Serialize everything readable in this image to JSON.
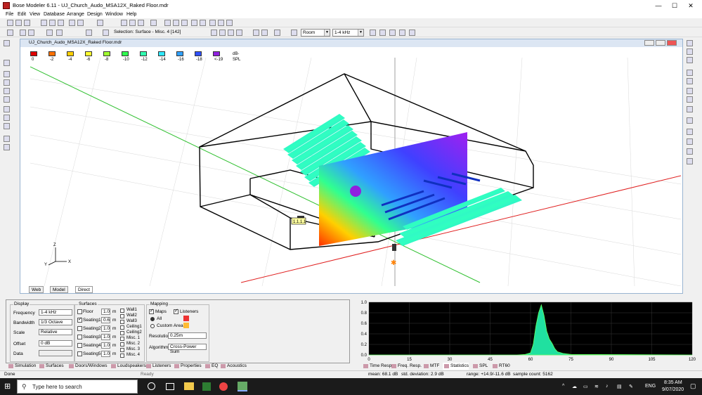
{
  "window": {
    "title": "Bose Modeler 6.11 - UJ_Church_Audo_MSA12X_Raked Floor.mdr",
    "min": "—",
    "max": "☐",
    "close": "✕"
  },
  "menu": [
    "File",
    "Edit",
    "View",
    "Database",
    "Arrange",
    "Design",
    "Window",
    "Help"
  ],
  "toolbar2": {
    "selection": "Selection: Surface - Misc. 4 [142]",
    "room": "Room",
    "band": "1-4 kHz"
  },
  "doc": {
    "title": "UJ_Church_Audo_MSA12X_Raked Floor.mdr"
  },
  "legend": {
    "items": [
      {
        "label": "0",
        "color": "#e00000"
      },
      {
        "label": "-2",
        "color": "#ff7000"
      },
      {
        "label": "-4",
        "color": "#ffd000"
      },
      {
        "label": "-6",
        "color": "#ffff30"
      },
      {
        "label": "-8",
        "color": "#a0ff30"
      },
      {
        "label": "-10",
        "color": "#30ff50"
      },
      {
        "label": "-12",
        "color": "#30ffb0"
      },
      {
        "label": "-14",
        "color": "#30e8ff"
      },
      {
        "label": "-16",
        "color": "#30a0ff"
      },
      {
        "label": "-18",
        "color": "#3050ff"
      },
      {
        "label": "<-19",
        "color": "#9020e0"
      }
    ],
    "unit": "dB-SPL"
  },
  "view": {
    "label": "1.1.1.1",
    "axes": {
      "x": "X",
      "y": "Y",
      "z": "Z"
    }
  },
  "viewtabs": [
    "Web",
    "Model",
    "Direct"
  ],
  "display": {
    "title": "Display",
    "frequency_label": "Frequency",
    "frequency": "1-4 kHz",
    "bandwidth_label": "Bandwidth",
    "bandwidth": "1/3 Octave",
    "scale_label": "Scale",
    "scale": "Relative",
    "offset_label": "Offset",
    "offset": "0 dB",
    "data_label": "Data"
  },
  "surfaces": {
    "title": "Surfaces",
    "rows": [
      {
        "name": "Floor",
        "val": "1.0",
        "unit": "m",
        "checked": false
      },
      {
        "name": "Seating1",
        "val": "0.6",
        "unit": "m",
        "checked": true
      },
      {
        "name": "Seating2",
        "val": "1.0",
        "unit": "m",
        "checked": false
      },
      {
        "name": "Seating3",
        "val": "1.0",
        "unit": "m",
        "checked": false
      },
      {
        "name": "Seating4",
        "val": "1.0",
        "unit": "m",
        "checked": false
      },
      {
        "name": "Seating5",
        "val": "1.0",
        "unit": "m",
        "checked": false
      }
    ],
    "col2": [
      "Wall1",
      "Wall2",
      "Wall3",
      "Ceiling1",
      "Ceiling2",
      "Misc. 1",
      "Misc. 2",
      "Misc. 3",
      "Misc. 4"
    ]
  },
  "mapping": {
    "title": "Mapping",
    "maps": "Maps",
    "listeners": "Listeners",
    "all": "All",
    "custom": "Custom Areas",
    "resolution_label": "Resolution",
    "resolution": "0.25m",
    "algorithm_label": "Algorithm",
    "algorithm": "Cross-Power Sum"
  },
  "bottomtabs": [
    "Simulation",
    "Surfaces",
    "Doors/Windows",
    "Loudspeakers",
    "Listeners",
    "Properties",
    "EQ",
    "Acoustics"
  ],
  "righttabs": [
    "Time Resp.",
    "Freq. Resp.",
    "MTF",
    "Statistics",
    "SPL",
    "RT60"
  ],
  "chart_data": {
    "type": "area",
    "x": [
      0,
      55,
      58,
      60,
      61,
      62,
      63,
      64,
      65,
      66,
      67,
      68,
      69,
      70,
      72,
      75,
      120
    ],
    "values": [
      0,
      0,
      0.01,
      0.04,
      0.2,
      0.55,
      0.8,
      0.95,
      0.75,
      0.45,
      0.3,
      0.22,
      0.12,
      0.06,
      0.03,
      0.01,
      0
    ],
    "xlim": [
      0,
      120
    ],
    "ylim": [
      0,
      1
    ],
    "xticks": [
      "0",
      "15",
      "30",
      "45",
      "60",
      "75",
      "90",
      "105",
      "120"
    ],
    "yticks": [
      "0.0",
      "0.2",
      "0.4",
      "0.6",
      "0.8",
      "1.0"
    ]
  },
  "status": {
    "left": "Done",
    "mid": "Ready",
    "mean": "mean: 68.1 dB",
    "std": "std. deviation: 2.9 dB",
    "range": "range: +14.9/-11.6 dB",
    "count": "sample count: 5162"
  },
  "taskbar": {
    "search": "Type here to search",
    "lang": "ENG",
    "time": "8:35 AM",
    "date": "9/07/2020"
  }
}
